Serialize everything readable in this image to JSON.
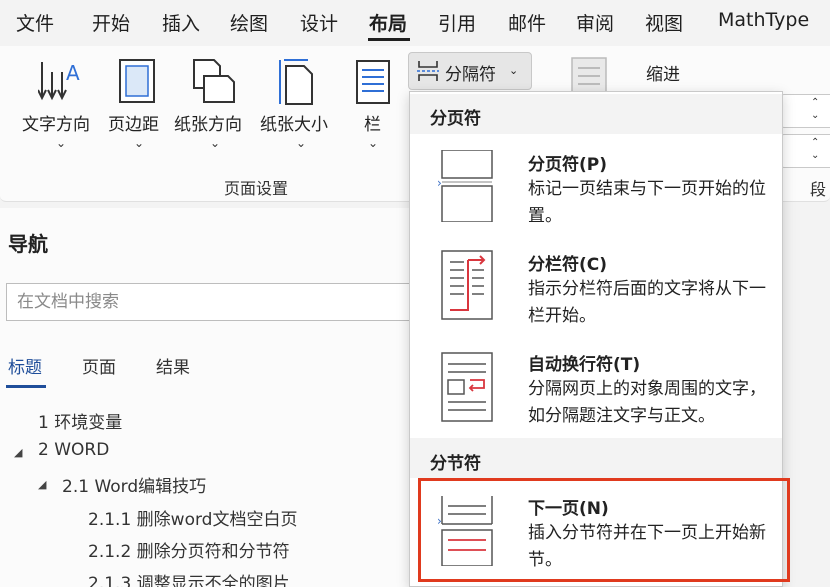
{
  "menu": {
    "items": [
      "文件",
      "开始",
      "插入",
      "绘图",
      "设计",
      "布局",
      "引用",
      "邮件",
      "审阅",
      "视图",
      "MathType"
    ],
    "active_index": 5
  },
  "ribbon": {
    "text_direction": "文字方向",
    "margins": "页边距",
    "orientation": "纸张方向",
    "size": "纸张大小",
    "columns": "栏",
    "breaks": "分隔符",
    "indent": "缩进",
    "page_setup_group": "页面设置",
    "paragraph_group": "段"
  },
  "nav": {
    "title": "导航",
    "search_placeholder": "在文档中搜索",
    "tabs": [
      "标题",
      "页面",
      "结果"
    ],
    "tree": [
      {
        "text": "1 环境变量",
        "level": 0,
        "expander": ""
      },
      {
        "text": "2 WORD",
        "level": 0,
        "expander": "◢"
      },
      {
        "text": "2.1 Word编辑技巧",
        "level": 1,
        "expander": "◢"
      },
      {
        "text": "2.1.1 删除word文档空白页",
        "level": 2,
        "expander": ""
      },
      {
        "text": "2.1.2 删除分页符和分节符",
        "level": 2,
        "expander": ""
      },
      {
        "text": "2.1.3 调整显示不全的图片",
        "level": 2,
        "expander": ""
      }
    ]
  },
  "dropdown": {
    "page_breaks_header": "分页符",
    "section_breaks_header": "分节符",
    "items": [
      {
        "title": "分页符(P)",
        "desc": "标记一页结束与下一页开始的位置。",
        "icon": "page-break-icon"
      },
      {
        "title": "分栏符(C)",
        "desc": "指示分栏符后面的文字将从下一栏开始。",
        "icon": "column-break-icon"
      },
      {
        "title": "自动换行符(T)",
        "desc": "分隔网页上的对象周围的文字，如分隔题注文字与正文。",
        "icon": "text-wrapping-break-icon"
      },
      {
        "title": "下一页(N)",
        "desc": "插入分节符并在下一页上开始新节。",
        "icon": "next-page-section-icon"
      }
    ]
  },
  "colors": {
    "accent_blue": "#1f4e9a",
    "highlight_red": "#e03a1e"
  }
}
